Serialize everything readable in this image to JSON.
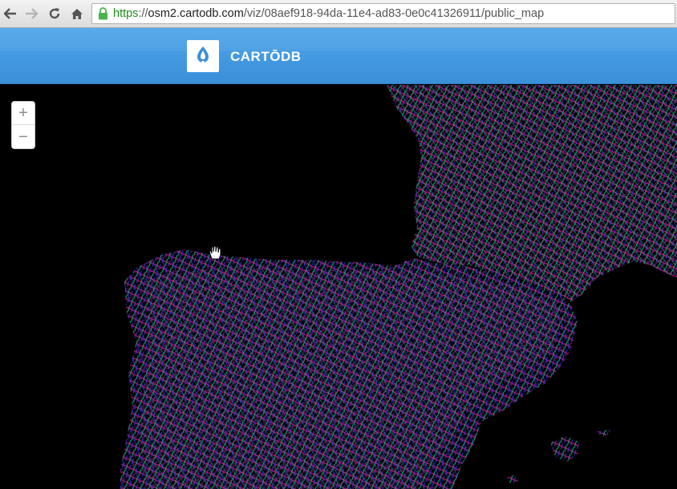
{
  "browser": {
    "url_scheme": "https",
    "url_sep": "://",
    "url_host": "osm2.cartodb.com",
    "url_path": "/viz/08aef918-94da-11e4-ad83-0e0c41326911/public_map",
    "icons": [
      "back-arrow-icon",
      "forward-arrow-icon",
      "reload-icon",
      "home-icon",
      "lock-icon"
    ]
  },
  "header": {
    "brand": "CARTŌDB",
    "background": "#3f97e0"
  },
  "map": {
    "zoom_in_label": "+",
    "zoom_out_label": "−",
    "palette": [
      "#c2166f",
      "#13a07a",
      "#3b2bd4",
      "#1b3fb8"
    ]
  }
}
